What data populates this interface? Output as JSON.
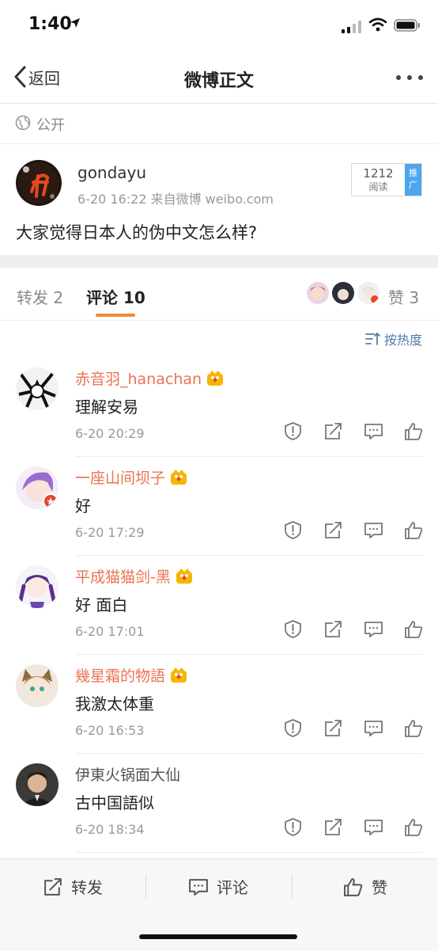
{
  "status_bar": {
    "time": "1:40"
  },
  "nav": {
    "back_label": "返回",
    "title": "微博正文"
  },
  "visibility": {
    "label": "公开"
  },
  "post": {
    "author": "gondayu",
    "meta": "6-20 16:22  来自微博 weibo.com",
    "reads_count": "1212",
    "reads_label": "阅读",
    "promote_label": "推广",
    "content": "大家觉得日本人的伪中文怎么样?"
  },
  "tabs": {
    "forward": "转发 2",
    "comment": "评论 10",
    "likes": "赞 3"
  },
  "sort": {
    "label": "按热度"
  },
  "comments": [
    {
      "name": "赤音羽_hanachan",
      "text": "理解安易",
      "time": "6-20 20:29"
    },
    {
      "name": "一座山间坝子",
      "text": "好",
      "time": "6-20 17:29"
    },
    {
      "name": "平成猫猫剑-黑",
      "text": "好 面白",
      "time": "6-20 17:01"
    },
    {
      "name": "幾星霜的物語",
      "text": "我激太体重",
      "time": "6-20 16:53"
    },
    {
      "name": "伊東火锅面大仙",
      "text": "古中国語似",
      "time": "6-20 18:34"
    }
  ],
  "bottom_bar": {
    "forward": "转发",
    "comment": "评论",
    "like": "赞"
  },
  "colors": {
    "accent_orange": "#f18a33",
    "name_orange": "#eb7350",
    "link_blue": "#507daf",
    "promo_blue": "#4fa6ee"
  }
}
